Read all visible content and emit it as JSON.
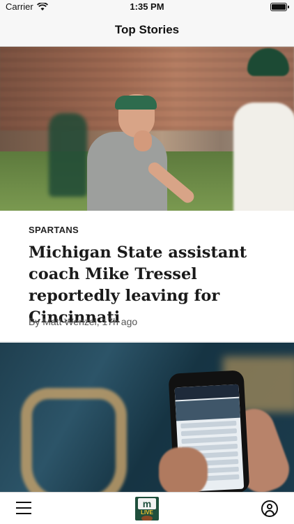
{
  "status_bar": {
    "carrier": "Carrier",
    "time": "1:35 PM",
    "wifi_icon": "wifi-icon",
    "battery_icon": "battery-icon"
  },
  "nav": {
    "title": "Top Stories"
  },
  "stories": [
    {
      "category": "SPARTANS",
      "headline": "Michigan State assistant coach Mike Tressel reportedly leaving for Cincinnati",
      "byline": "By Matt Wenzel, 17h ago"
    }
  ],
  "tab_bar": {
    "menu_icon": "hamburger-menu-icon",
    "logo_text": "m",
    "logo_subtext": "LIVE",
    "account_icon": "account-icon"
  },
  "colors": {
    "logo_green": "#1f4f3c",
    "bar_background": "#f7f7f7"
  }
}
